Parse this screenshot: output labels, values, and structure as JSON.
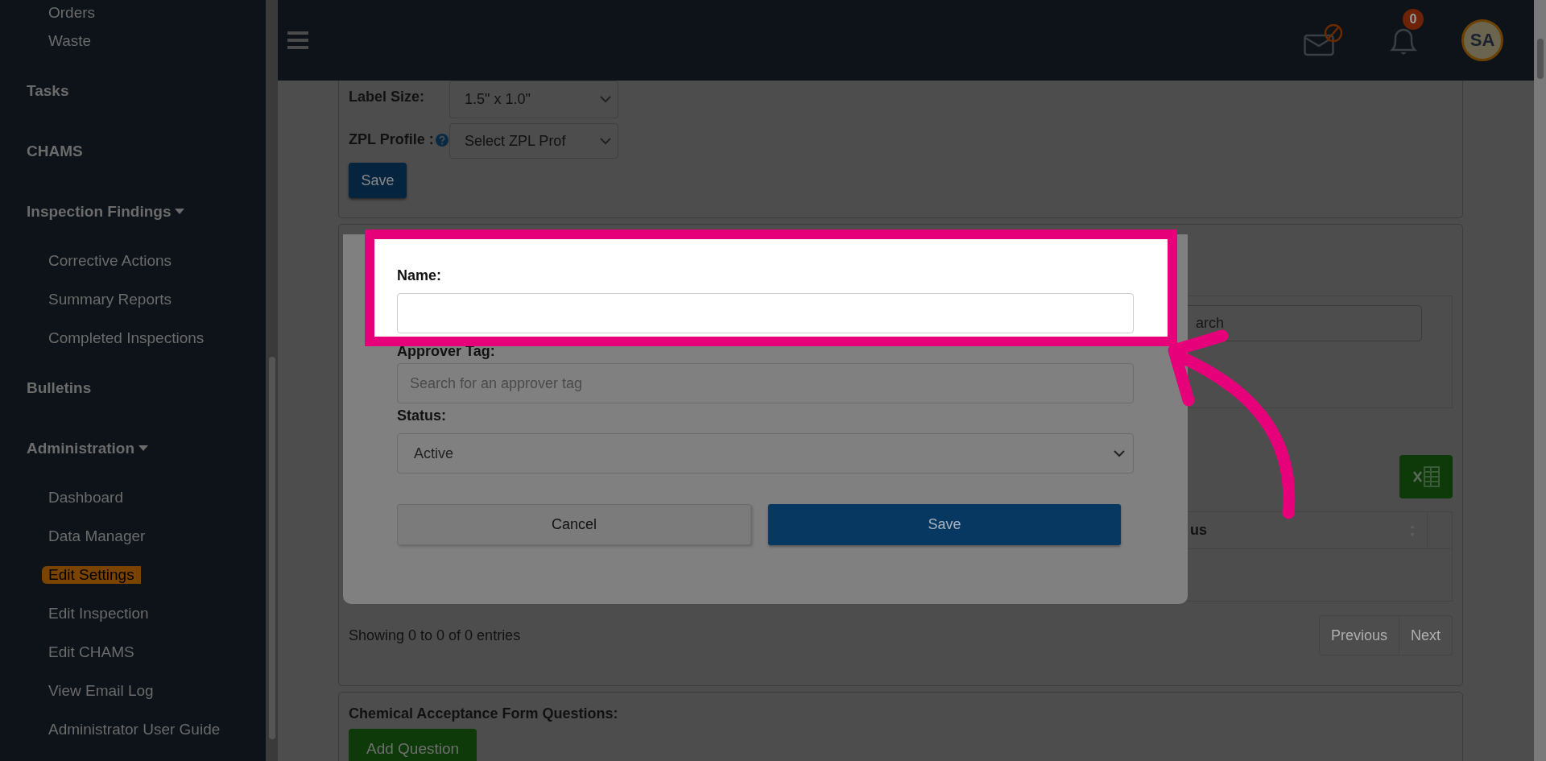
{
  "sidebar": {
    "items": [
      {
        "label": "Orders",
        "kind": "sub",
        "selected": false
      },
      {
        "label": "Waste",
        "kind": "sub",
        "selected": false
      },
      {
        "label": "Tasks",
        "kind": "section",
        "selected": false
      },
      {
        "label": "CHAMS",
        "kind": "section",
        "selected": false
      },
      {
        "label": "Inspection Findings",
        "kind": "group",
        "expanded": true,
        "selected": false
      },
      {
        "label": "Corrective Actions",
        "kind": "sub",
        "selected": false
      },
      {
        "label": "Summary Reports",
        "kind": "sub",
        "selected": false
      },
      {
        "label": "Completed Inspections",
        "kind": "sub",
        "selected": false
      },
      {
        "label": "Bulletins",
        "kind": "section",
        "selected": false
      },
      {
        "label": "Administration",
        "kind": "group",
        "expanded": true,
        "selected": false
      },
      {
        "label": "Dashboard",
        "kind": "sub",
        "selected": false
      },
      {
        "label": "Data Manager",
        "kind": "sub",
        "selected": false
      },
      {
        "label": "Edit Settings",
        "kind": "sub",
        "selected": true
      },
      {
        "label": "Edit Inspection",
        "kind": "sub",
        "selected": false
      },
      {
        "label": "Edit CHAMS",
        "kind": "sub",
        "selected": false
      },
      {
        "label": "View Email Log",
        "kind": "sub",
        "selected": false
      },
      {
        "label": "Administrator User Guide",
        "kind": "sub",
        "selected": false
      }
    ]
  },
  "topbar": {
    "notifications_badge": "0",
    "avatar_initials": "SA"
  },
  "label_settings": {
    "fields": [
      {
        "label": "Label Size:",
        "value": "1.5\" x 1.0\"",
        "help": false
      },
      {
        "label": "ZPL Profile :",
        "value": "Select ZPL Prof",
        "help": true
      }
    ],
    "save_button": "Save"
  },
  "list_panel": {
    "search_placeholder": "arch",
    "table": {
      "columns": [
        "us"
      ]
    },
    "info": "Showing 0 to 0 of 0 entries",
    "pagination": [
      "Previous",
      "Next"
    ]
  },
  "questions": {
    "title": "Chemical Acceptance Form Questions:",
    "add_button": "Add Question"
  },
  "modal": {
    "fields": [
      {
        "label": "Name:",
        "kind": "text",
        "highlighted": true
      },
      {
        "label": "Approver Tag:",
        "kind": "text",
        "placeholder": "Search for an approver tag",
        "highlighted": false
      },
      {
        "label": "Status:",
        "kind": "select",
        "value": "Active",
        "highlighted": false
      }
    ],
    "buttons": [
      {
        "label": "Cancel",
        "kind": "secondary"
      },
      {
        "label": "Save",
        "kind": "primary"
      }
    ]
  }
}
